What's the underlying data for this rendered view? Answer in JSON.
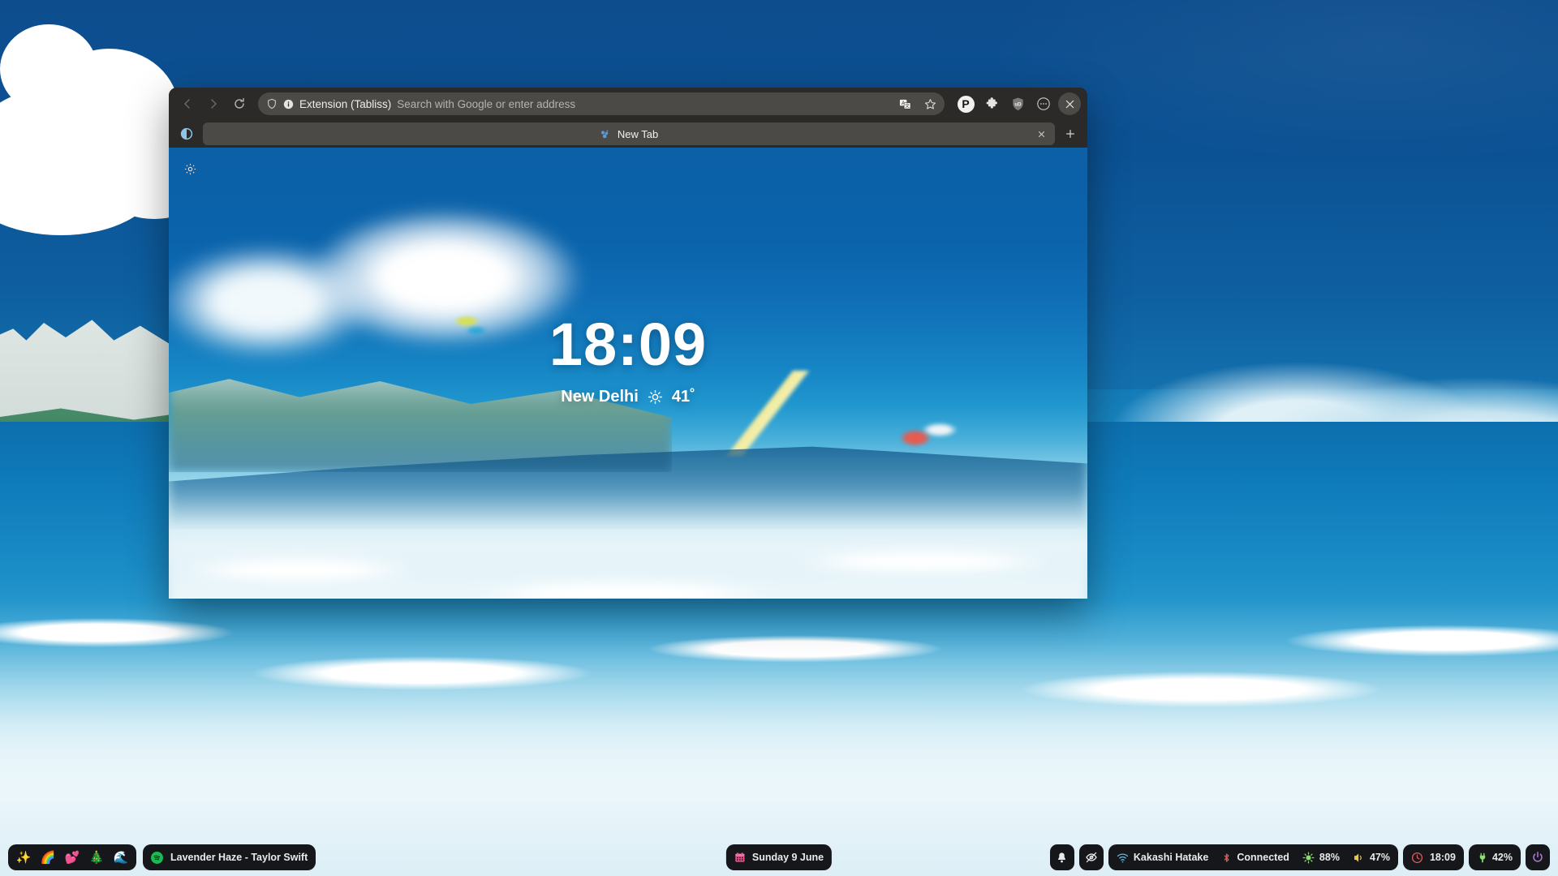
{
  "desktop": {
    "wallpaper_alt": "illustrated ocean wave and coastal town"
  },
  "browser": {
    "nav": {
      "back_label": "Back",
      "forward_label": "Forward",
      "reload_label": "Reload"
    },
    "urlbar": {
      "shield_icon": "shield-icon",
      "info_icon": "info-icon",
      "extension_label": "Extension (Tabliss)",
      "placeholder": "Search with Google or enter address",
      "translate_icon": "translate-icon",
      "bookmark_icon": "star-icon"
    },
    "toolbar_icons": [
      {
        "name": "profile-avatar",
        "label": "P"
      },
      {
        "name": "extensions-icon",
        "label": ""
      },
      {
        "name": "ublock-origin-icon",
        "label": "uD"
      },
      {
        "name": "app-menu-icon",
        "label": ""
      },
      {
        "name": "close-window-icon",
        "label": ""
      }
    ],
    "tabs": {
      "firefox_view_label": "Firefox View",
      "items": [
        {
          "title": "New Tab",
          "favicon": "tabliss-icon",
          "active": true
        }
      ],
      "close_label": "Close tab",
      "newtab_label": "New tab"
    }
  },
  "tabliss": {
    "settings_icon": "gear-icon",
    "time": "18:09",
    "location": "New Delhi",
    "weather_icon": "sun-icon",
    "temperature": "41˚"
  },
  "taskbar": {
    "workspaces": [
      {
        "name": "workspace-sparkles",
        "glyph": "✨"
      },
      {
        "name": "workspace-rainbow",
        "glyph": "🌈"
      },
      {
        "name": "workspace-hearts",
        "glyph": "💕"
      },
      {
        "name": "workspace-tree",
        "glyph": "🎄"
      },
      {
        "name": "workspace-wave",
        "glyph": "🌊"
      }
    ],
    "media": {
      "icon": "spotify-icon",
      "title": "Lavender Haze - Taylor Swift"
    },
    "date": {
      "icon": "calendar-icon",
      "text": "Sunday  9 June"
    },
    "tray": [
      {
        "name": "notifications-icon"
      },
      {
        "name": "eye-off-icon"
      }
    ],
    "status": [
      {
        "name": "wifi",
        "icon": "wifi-icon",
        "label": "Kakashi Hatake",
        "color": "#62b6e8"
      },
      {
        "name": "bluetooth",
        "icon": "bluetooth-icon",
        "label": "Connected",
        "color": "#e05b5b"
      },
      {
        "name": "brightness",
        "icon": "brightness-icon",
        "label": "88%",
        "color": "#8ae06a"
      }
    ],
    "volume": {
      "icon": "volume-icon",
      "label": "47%",
      "color": "#e8c84a"
    },
    "clock": {
      "icon": "clock-icon",
      "label": "18:09",
      "color": "#e05b5b"
    },
    "battery": {
      "icon": "plug-icon",
      "label": "42%",
      "color": "#8ae06a"
    },
    "power": {
      "icon": "power-icon",
      "color": "#b07ade"
    }
  }
}
